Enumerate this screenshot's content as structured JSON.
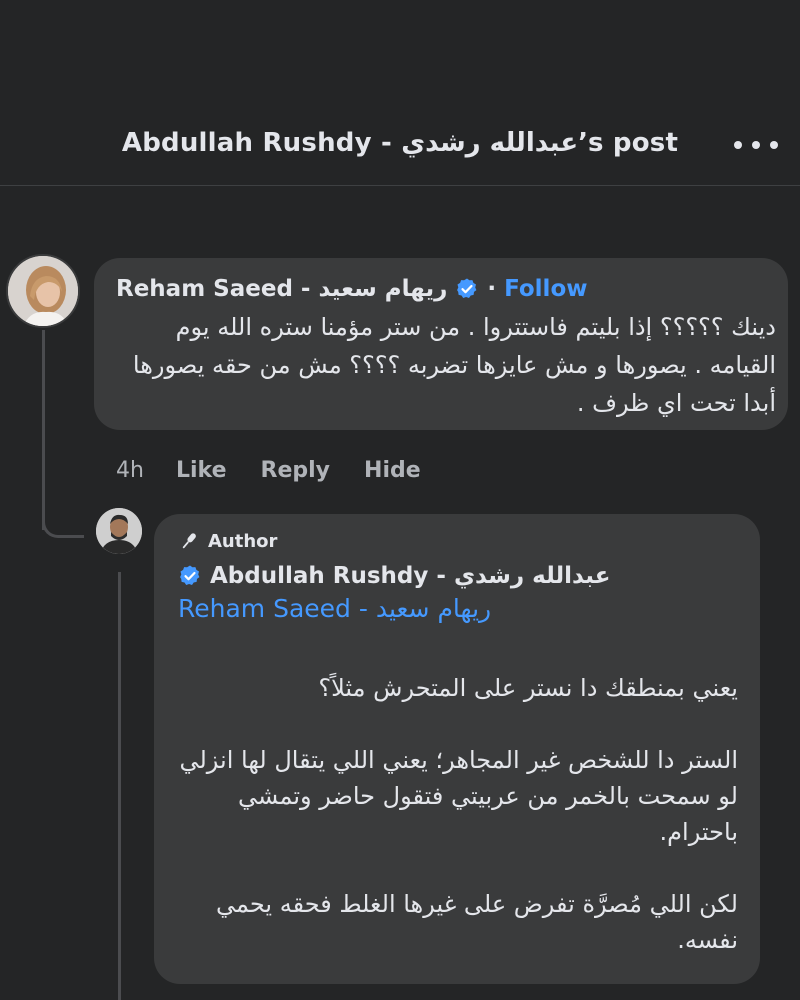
{
  "header": {
    "title": "Abdullah Rushdy - عبدالله رشدي’s post",
    "more_icon": "more-horizontal-icon"
  },
  "comment": {
    "author": "Reham Saeed - ريهام  سعيد",
    "separator": "·",
    "follow_label": "Follow",
    "verified_color": "#4599ff",
    "text": "دينك ؟؟؟؟؟ إذا بليتم فاستتروا . من ستر مؤمنا ستره الله يوم القيامه . يصورها و مش عايزها تضربه ؟؟؟؟ مش من حقه يصورها أبدا تحت اي ظرف .",
    "time": "4h",
    "actions": {
      "like": "Like",
      "reply": "Reply",
      "hide": "Hide"
    }
  },
  "reply": {
    "badge": "Author",
    "author": "Abdullah Rushdy -  عبدالله  رشدي",
    "mention": "Reham Saeed - ريهام سعيد",
    "paragraphs": [
      "يعني بمنطقك دا نستر على المتحرش مثلاً؟",
      "الستر دا للشخص غير المجاهر؛ يعني اللي يتقال لها انزلي لو سمحت بالخمر من عربيتي فتقول حاضر وتمشي باحترام.",
      "لكن اللي مُصرَّة تفرض على غيرها الغلط فحقه يحمي نفسه."
    ]
  },
  "colors": {
    "background": "#242526",
    "bubble": "#3a3b3c",
    "text": "#e4e6eb",
    "secondary": "#b0b3b8",
    "link": "#4599ff"
  }
}
